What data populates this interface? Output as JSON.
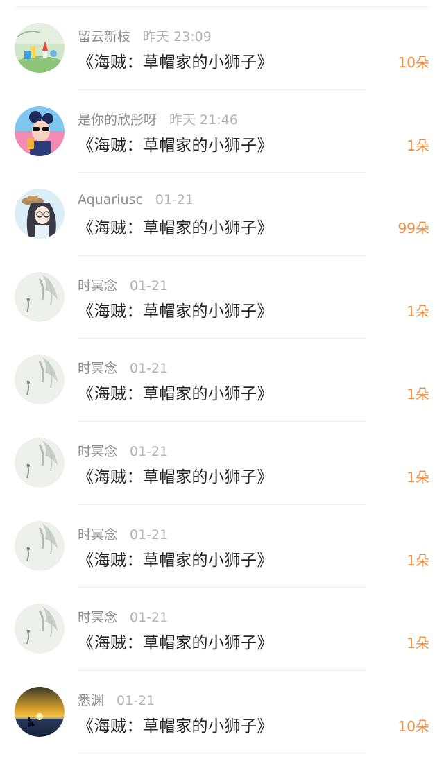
{
  "colors": {
    "count_accent": "#f08a3c",
    "name_gray": "#8c8c8c",
    "time_gray": "#b2b2b2",
    "title_dark": "#222222"
  },
  "gifts": [
    {
      "name": "留云新枝",
      "time": "昨天 23:09",
      "title": "《海贼：草帽家的小狮子》",
      "count": "10朵",
      "avatar": "garden-figurine-avatar"
    },
    {
      "name": "是你的欣彤呀",
      "time": "昨天 21:46",
      "title": "《海贼：草帽家的小狮子》",
      "count": "1朵",
      "avatar": "sunglasses-girl-avatar"
    },
    {
      "name": "Aquariusc",
      "time": "01-21",
      "title": "《海贼：草帽家的小狮子》",
      "count": "99朵",
      "avatar": "anime-hat-avatar"
    },
    {
      "name": "时冥念",
      "time": "01-21",
      "title": "《海贼：草帽家的小狮子》",
      "count": "1朵",
      "avatar": "ink-wash-avatar"
    },
    {
      "name": "时冥念",
      "time": "01-21",
      "title": "《海贼：草帽家的小狮子》",
      "count": "1朵",
      "avatar": "ink-wash-avatar"
    },
    {
      "name": "时冥念",
      "time": "01-21",
      "title": "《海贼：草帽家的小狮子》",
      "count": "1朵",
      "avatar": "ink-wash-avatar"
    },
    {
      "name": "时冥念",
      "time": "01-21",
      "title": "《海贼：草帽家的小狮子》",
      "count": "1朵",
      "avatar": "ink-wash-avatar"
    },
    {
      "name": "时冥念",
      "time": "01-21",
      "title": "《海贼：草帽家的小狮子》",
      "count": "1朵",
      "avatar": "ink-wash-avatar"
    },
    {
      "name": "悉渊",
      "time": "01-21",
      "title": "《海贼：草帽家的小狮子》",
      "count": "10朵",
      "avatar": "sunset-sea-avatar"
    }
  ]
}
